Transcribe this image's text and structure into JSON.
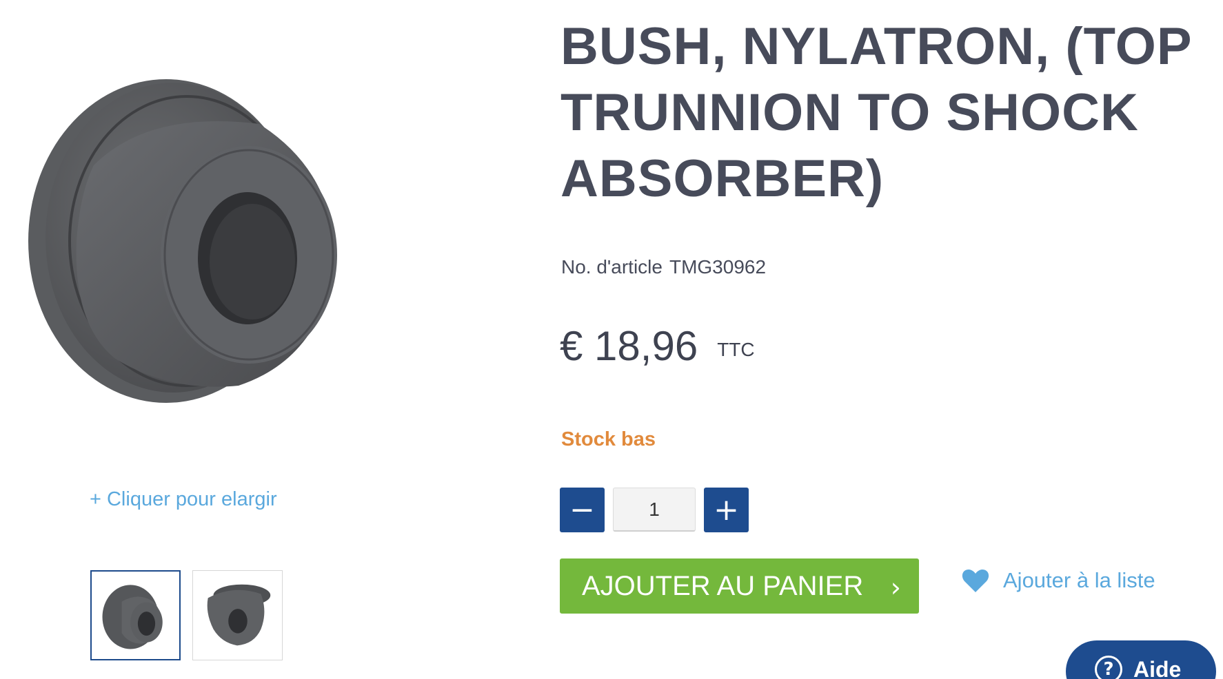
{
  "gallery": {
    "main_image_icon": "bushing-product-image",
    "enlarge_label": "+ Cliquer pour elargir",
    "thumbnails": [
      "bushing-thumbnail-front",
      "bushing-thumbnail-angle"
    ]
  },
  "product": {
    "title": "BUSH, NYLATRON, (TOP TRUNNION TO SHOCK ABSORBER)",
    "sku_label": "No. d'article",
    "sku_value": "TMG30962",
    "price": "€ 18,96",
    "price_suffix": "TTC",
    "stock_status": "Stock bas",
    "stock_color": "#e18a3c"
  },
  "quantity": {
    "minus_label": "−",
    "value": "1",
    "plus_label": "+"
  },
  "actions": {
    "add_to_cart_label": "AJOUTER AU PANIER",
    "add_to_cart_chevron": "›",
    "add_to_cart_color": "#74b83c",
    "wishlist_label": "Ajouter à la liste",
    "wishlist_icon": "heart-icon"
  },
  "help": {
    "icon": "?",
    "label": "Aide"
  },
  "colors": {
    "primary_blue": "#1e4c8f",
    "link_blue": "#5aa8dd",
    "title_text": "#474b5a"
  }
}
